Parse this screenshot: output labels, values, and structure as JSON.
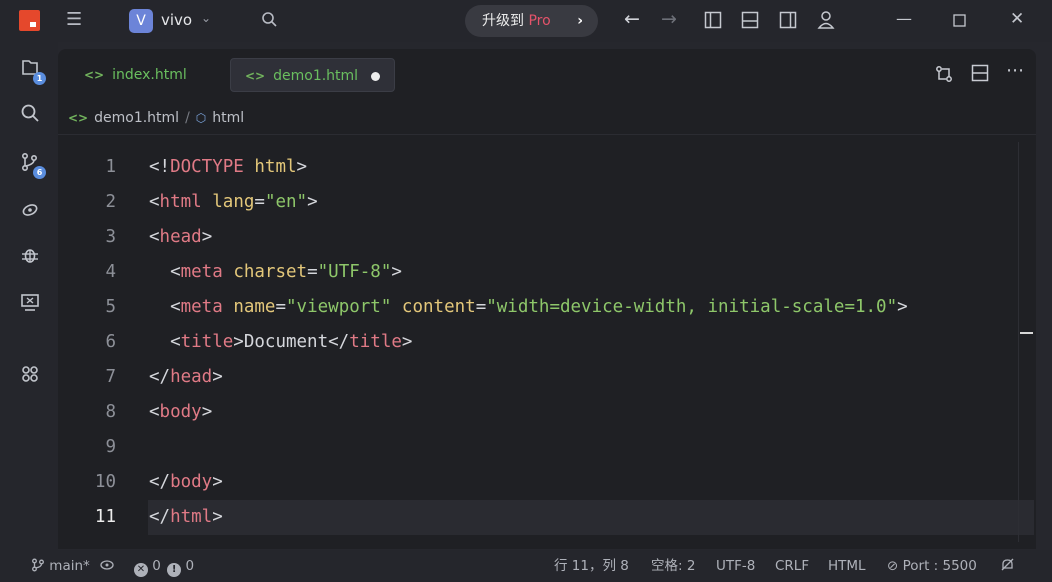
{
  "titlebar": {
    "project_initial": "V",
    "project_name": "vivo",
    "upgrade_text": "升级到 ",
    "upgrade_pro": "Pro"
  },
  "activity": {
    "explorer_badge": "1",
    "scm_badge": "6"
  },
  "tabs": [
    {
      "label": "index.html",
      "active": false
    },
    {
      "label": "demo1.html",
      "active": true,
      "modified": true
    }
  ],
  "breadcrumb": {
    "file": "demo1.html",
    "symbol": "html"
  },
  "editor": {
    "current_line": 11,
    "lines": [
      {
        "n": "1",
        "tokens": [
          [
            "p",
            "<!"
          ],
          [
            "k",
            "DOCTYPE"
          ],
          [
            "p",
            " "
          ],
          [
            "a",
            "html"
          ],
          [
            "p",
            ">"
          ]
        ]
      },
      {
        "n": "2",
        "tokens": [
          [
            "p",
            "<"
          ],
          [
            "k",
            "html"
          ],
          [
            "p",
            " "
          ],
          [
            "a",
            "lang"
          ],
          [
            "p",
            "="
          ],
          [
            "s",
            "\"en\""
          ],
          [
            "p",
            ">"
          ]
        ]
      },
      {
        "n": "3",
        "tokens": [
          [
            "p",
            "<"
          ],
          [
            "k",
            "head"
          ],
          [
            "p",
            ">"
          ]
        ]
      },
      {
        "n": "4",
        "tokens": [
          [
            "p",
            "  <"
          ],
          [
            "k",
            "meta"
          ],
          [
            "p",
            " "
          ],
          [
            "a",
            "charset"
          ],
          [
            "p",
            "="
          ],
          [
            "s",
            "\"UTF-8\""
          ],
          [
            "p",
            ">"
          ]
        ]
      },
      {
        "n": "5",
        "tokens": [
          [
            "p",
            "  <"
          ],
          [
            "k",
            "meta"
          ],
          [
            "p",
            " "
          ],
          [
            "a",
            "name"
          ],
          [
            "p",
            "="
          ],
          [
            "s",
            "\"viewport\""
          ],
          [
            "p",
            " "
          ],
          [
            "a",
            "content"
          ],
          [
            "p",
            "="
          ],
          [
            "s",
            "\"width=device-width, initial-scale=1.0\""
          ],
          [
            "p",
            ">"
          ]
        ]
      },
      {
        "n": "6",
        "tokens": [
          [
            "p",
            "  <"
          ],
          [
            "k",
            "title"
          ],
          [
            "p",
            ">"
          ],
          [
            "x",
            "Document"
          ],
          [
            "p",
            "</"
          ],
          [
            "k",
            "title"
          ],
          [
            "p",
            ">"
          ]
        ]
      },
      {
        "n": "7",
        "tokens": [
          [
            "p",
            "</"
          ],
          [
            "k",
            "head"
          ],
          [
            "p",
            ">"
          ]
        ]
      },
      {
        "n": "8",
        "tokens": [
          [
            "p",
            "<"
          ],
          [
            "k",
            "body"
          ],
          [
            "p",
            ">"
          ]
        ]
      },
      {
        "n": "9",
        "tokens": []
      },
      {
        "n": "10",
        "tokens": [
          [
            "p",
            "</"
          ],
          [
            "k",
            "body"
          ],
          [
            "p",
            ">"
          ]
        ]
      },
      {
        "n": "11",
        "tokens": [
          [
            "p",
            "</"
          ],
          [
            "k",
            "html"
          ],
          [
            "p",
            ">"
          ]
        ]
      }
    ]
  },
  "status": {
    "branch": "main*",
    "errors": "0",
    "warnings": "0",
    "position": "行 11，列 8",
    "indent": "空格: 2",
    "encoding": "UTF-8",
    "eol": "CRLF",
    "language": "HTML",
    "port": "Port : 5500"
  }
}
